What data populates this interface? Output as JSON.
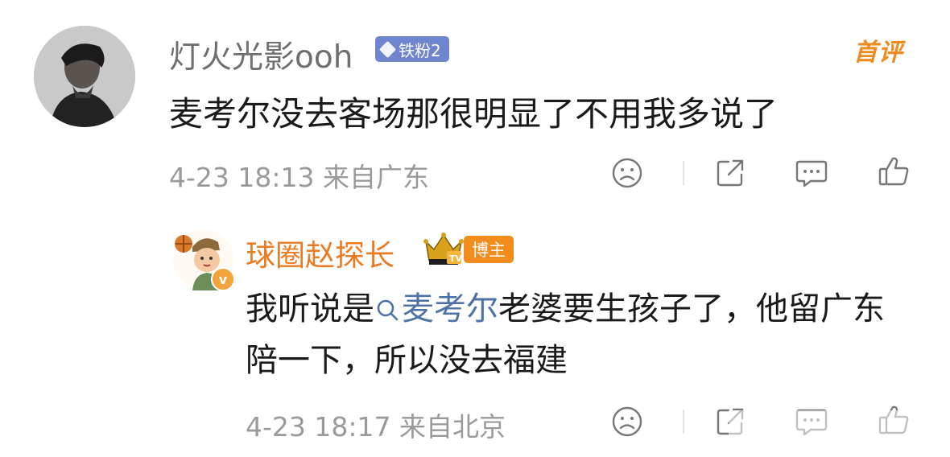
{
  "top_comment": {
    "username": "灯火光影ooh",
    "fan_badge": "铁粉2",
    "first_comment_tag": "首评",
    "text": "麦考尔没去客场那很明显了不用我多说了",
    "meta": "4-23 18:13 来自广东",
    "actions": {
      "react_icon": "sad-face-icon",
      "share_icon": "share-icon",
      "comment_icon": "comment-icon",
      "like_icon": "thumbs-up-icon"
    }
  },
  "reply": {
    "username": "球圈赵探长",
    "blogger_badge": "博主",
    "text_before": "我听说是",
    "mention": "麦考尔",
    "text_after": "老婆要生孩子了，他留广东陪一下，所以没去福建",
    "meta": "4-23 18:17 来自北京",
    "verified_mark": "v"
  },
  "colors": {
    "username_gray": "#6f6f6f",
    "blogger_orange": "#eb7b22",
    "mention_blue": "#4e72a6",
    "fan_badge_blue": "#6f86cf",
    "meta_gray": "#9a9a9a"
  }
}
